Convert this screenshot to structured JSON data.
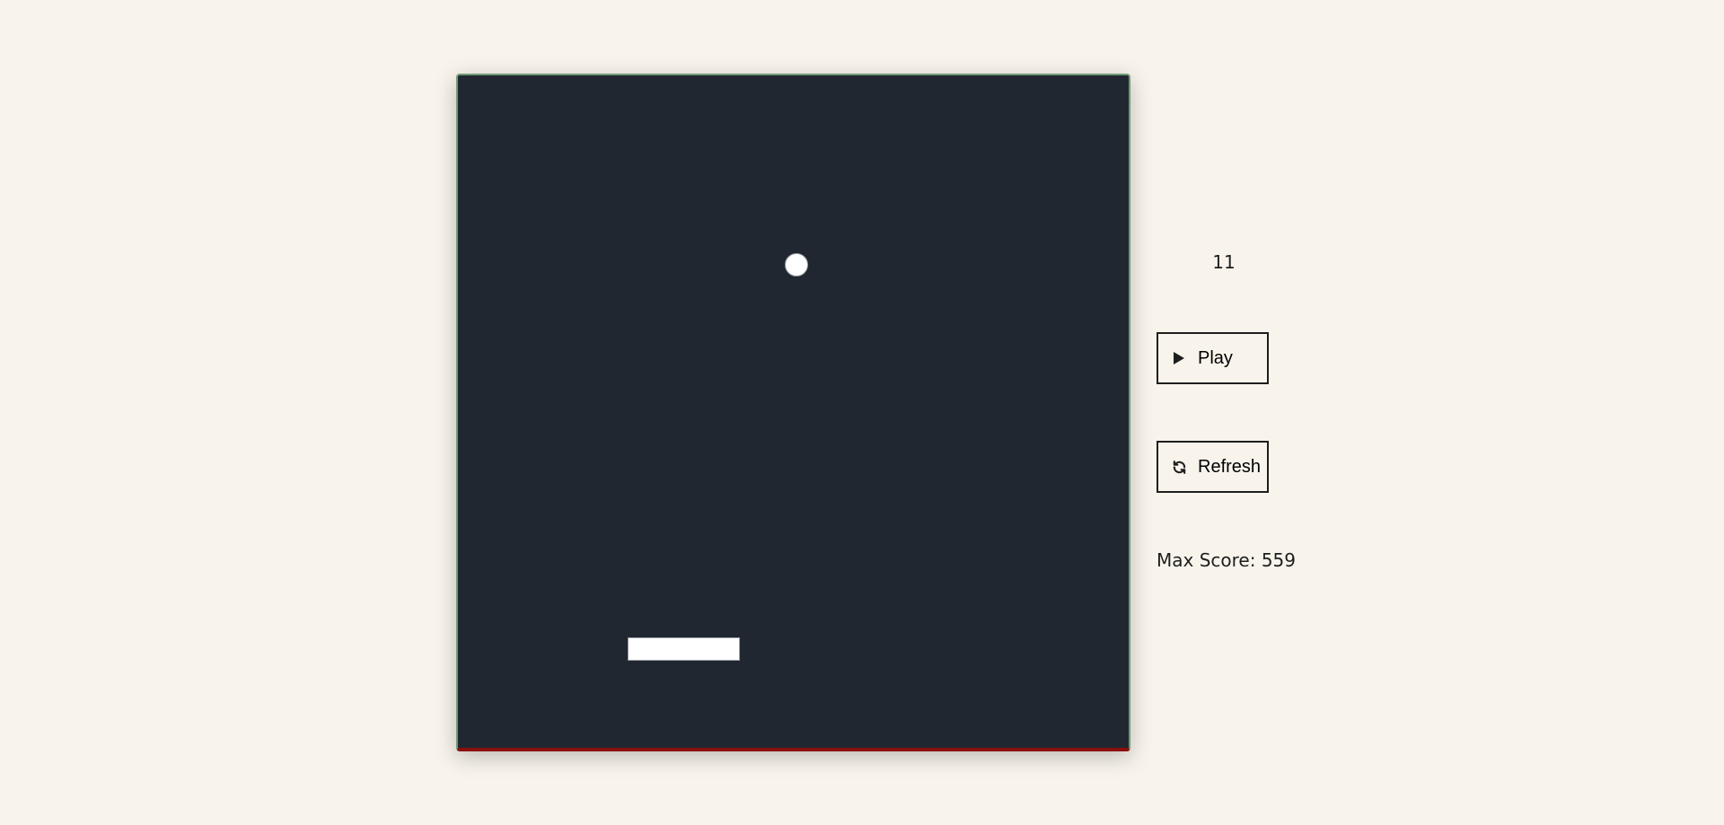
{
  "game": {
    "score": "11",
    "max_score_text": "Max Score: 559"
  },
  "controls": {
    "play_label": "Play",
    "refresh_label": "Refresh"
  },
  "icons": {
    "play": "play-icon",
    "refresh": "refresh-icon"
  },
  "colors": {
    "background": "#f8f4ec",
    "board": "#212731",
    "board_border": "#6f9a74",
    "board_bottom": "#8a0f0f",
    "ball": "#ffffff",
    "paddle": "#ffffff"
  }
}
